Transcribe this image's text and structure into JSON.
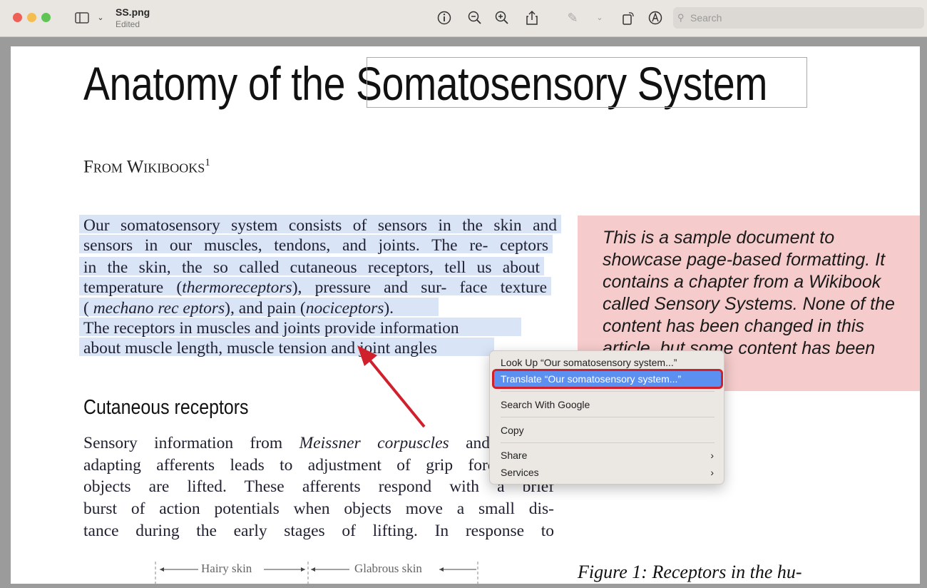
{
  "window": {
    "filename": "SS.png",
    "status": "Edited",
    "search_placeholder": "Search"
  },
  "toolbar_icons": [
    "sidebar-icon",
    "chevron-down-icon",
    "info-icon",
    "zoom-out-icon",
    "zoom-in-icon",
    "share-icon",
    "highlight-pen-icon",
    "chevron-down-icon",
    "rotate-icon",
    "markup-icon",
    "search-icon"
  ],
  "document": {
    "title_a": "Anatomy of the",
    "title_b": "Somatosensory System",
    "byline": "From Wikibooks",
    "footnote": "1",
    "selected_lines": [
      [
        {
          "t": "Our somatosensory system consists of  sensors in the skin  and"
        }
      ],
      [
        {
          "t": "sensors in our  muscles, tendons, and  joints. The re- ceptors"
        }
      ],
      [
        {
          "t": "in the skin, the so  called cutaneous receptors,  tell  us about"
        }
      ],
      [
        {
          "t": "temperature ("
        },
        {
          "t": "thermoreceptors",
          "i": true
        },
        {
          "t": "),  pressure and sur- face  texture"
        }
      ],
      [
        {
          "t": "( "
        },
        {
          "t": "mechano  rec  eptors",
          "i": true
        },
        {
          "t": "),  and  pain  ("
        },
        {
          "t": "nociceptors",
          "i": true
        },
        {
          "t": ")."
        }
      ],
      [
        {
          "t": "The  receptors  in  muscles  and  joints  provide  information"
        }
      ],
      [
        {
          "t": "about muscle length, muscle   tension  and joint angles"
        }
      ]
    ],
    "section_heading": "Cutaneous receptors",
    "section_lines": [
      [
        {
          "t": "Sensory information from "
        },
        {
          "t": "Meissner corpuscles",
          "i": true
        },
        {
          "t": " and rapidly"
        }
      ],
      [
        {
          "t": "adapting afferents leads to adjustment of grip force when"
        }
      ],
      [
        {
          "t": "objects  are  lifted.  These  afferents  respond  with  a  brief"
        }
      ],
      [
        {
          "t": "burst of action potentials when objects move a small dis-"
        }
      ],
      [
        {
          "t": "tance  during  the  early  stages  of  lifting.  In  response  to"
        }
      ]
    ],
    "sidebox_lines": [
      "This is a sample document to",
      "showcase page-based formatting. It",
      "contains a chapter from a Wikibook",
      "called Sensory Systems. None of the",
      "content has been changed in this",
      "article, but some content has been"
    ],
    "figure_labels": {
      "hairy": "Hairy skin",
      "glabrous": "Glabrous skin"
    },
    "figure_caption": "Figure 1:   Receptors  in  the  hu-"
  },
  "context_menu": {
    "items": [
      "Look Up “Our somatosensory system...”",
      "Translate “Our somatosensory system...”",
      "Search With Google",
      "Copy",
      "Share",
      "Services"
    ],
    "highlighted": "Translate “Our somatosensory system...”",
    "submenu_arrow": "›"
  },
  "colors": {
    "selection": "#d9e4f7",
    "sidebox": "#f5cbcb",
    "menu_highlight": "#5b8ff0",
    "annotation_red": "#d0202c"
  }
}
